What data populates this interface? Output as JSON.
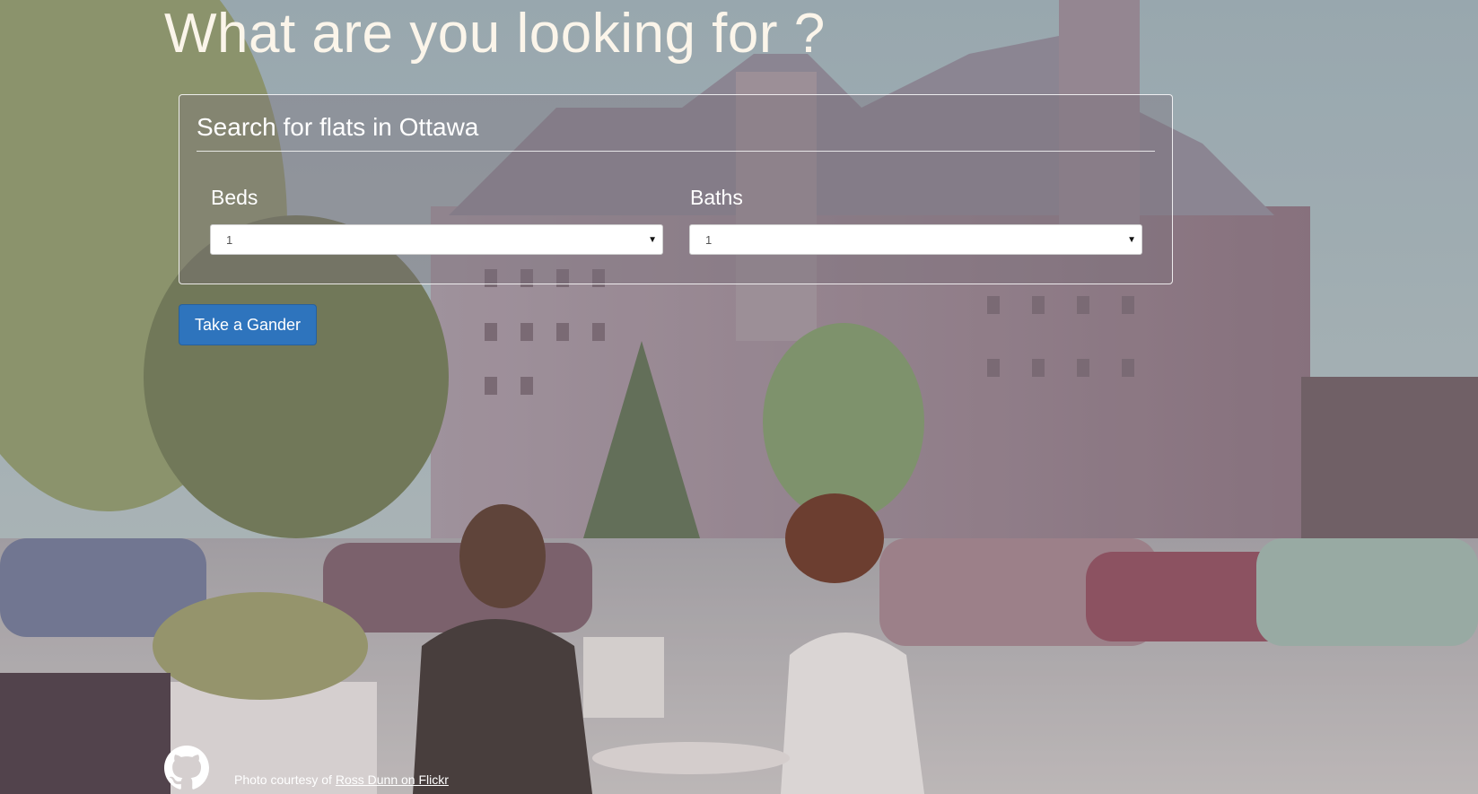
{
  "headline": "What are you looking for ?",
  "search": {
    "title": "Search for flats in Ottawa",
    "beds": {
      "label": "Beds",
      "selected": "1"
    },
    "baths": {
      "label": "Baths",
      "selected": "1"
    }
  },
  "cta": {
    "label": "Take a Gander"
  },
  "footer": {
    "credit_prefix": "Photo courtesy of ",
    "credit_link": "Ross Dunn on Flickr",
    "github_icon": "github-octocat-icon"
  },
  "colors": {
    "headline": "#fbf5ea",
    "button": "#2e74bd"
  }
}
